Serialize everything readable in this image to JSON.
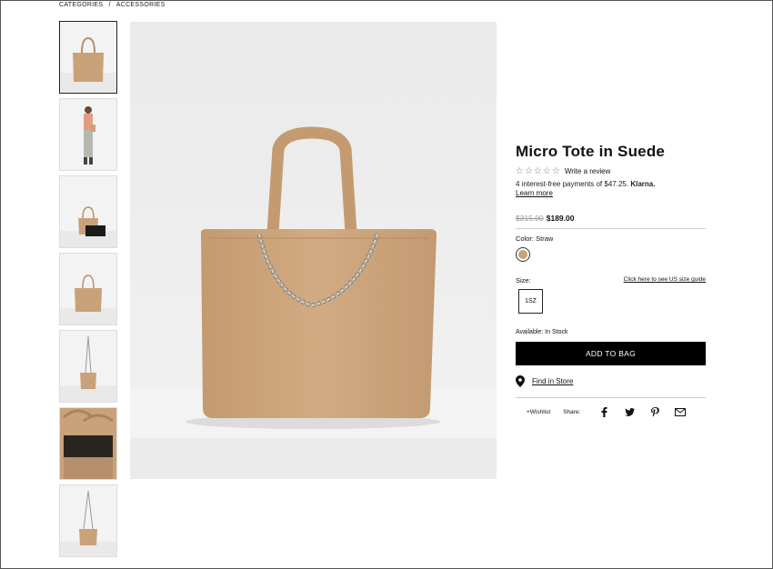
{
  "breadcrumb": {
    "items": [
      "CATEGORIES",
      "/",
      "ACCESSORIES"
    ]
  },
  "product": {
    "title": "Micro Tote in Suede",
    "review_link": "Write a review",
    "stars": "☆☆☆☆☆",
    "klarna_text": "4 interest-free payments of $47.25.",
    "klarna_brand": "Klarna.",
    "learn_more": "Learn more",
    "price_old": "$315.00",
    "price_new": "$189.00",
    "color_label": "Color:",
    "color_value": "Straw",
    "swatch_color": "#c9a27a",
    "size_label": "Size:",
    "size_guide": "Click here to see US size guide",
    "size_option": "1SZ",
    "availability": "Available: In Stock",
    "add_to_bag": "ADD TO BAG",
    "find_in_store": "Find in Store",
    "wishlist": "+Wishlist",
    "share": "Share:"
  },
  "colors": {
    "bag": "#c9a27a",
    "accent": "#000000"
  },
  "thumbnails": [
    {
      "name": "thumb-front",
      "active": true
    },
    {
      "name": "thumb-model"
    },
    {
      "name": "thumb-with-pouch"
    },
    {
      "name": "thumb-front-2"
    },
    {
      "name": "thumb-crossbody"
    },
    {
      "name": "thumb-interior"
    },
    {
      "name": "thumb-crossbody-2"
    }
  ],
  "icons": [
    "location-pin-icon",
    "facebook-icon",
    "twitter-icon",
    "pinterest-icon",
    "email-icon"
  ]
}
